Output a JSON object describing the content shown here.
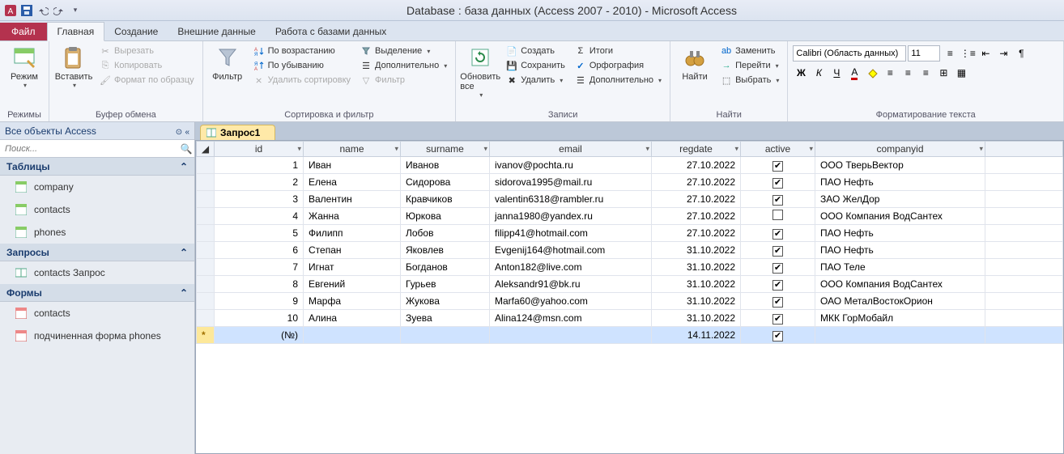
{
  "title": "Database : база данных (Access 2007 - 2010) - Microsoft Access",
  "tabs": {
    "file": "Файл",
    "home": "Главная",
    "create": "Создание",
    "external": "Внешние данные",
    "dbtools": "Работа с базами данных"
  },
  "ribbon": {
    "modes": {
      "view": "Режим",
      "group": "Режимы"
    },
    "clipboard": {
      "paste": "Вставить",
      "cut": "Вырезать",
      "copy": "Копировать",
      "format": "Формат по образцу",
      "group": "Буфер обмена"
    },
    "sortfilter": {
      "filter": "Фильтр",
      "asc": "По возрастанию",
      "desc": "По убыванию",
      "clear": "Удалить сортировку",
      "selection": "Выделение",
      "advanced": "Дополнительно",
      "toggle": "Фильтр",
      "group": "Сортировка и фильтр"
    },
    "records": {
      "refresh": "Обновить все",
      "new": "Создать",
      "save": "Сохранить",
      "delete": "Удалить",
      "totals": "Итоги",
      "spelling": "Орфография",
      "more": "Дополнительно",
      "group": "Записи"
    },
    "find": {
      "find": "Найти",
      "replace": "Заменить",
      "goto": "Перейти",
      "select": "Выбрать",
      "group": "Найти"
    },
    "textfmt": {
      "font": "Calibri (Область данных)",
      "size": "11",
      "group": "Форматирование текста"
    }
  },
  "nav": {
    "header": "Все объекты Access",
    "search_placeholder": "Поиск...",
    "cats": {
      "tables": "Таблицы",
      "queries": "Запросы",
      "forms": "Формы"
    },
    "tables": [
      "company",
      "contacts",
      "phones"
    ],
    "queries": [
      "contacts Запрос"
    ],
    "forms": [
      "contacts",
      "подчиненная форма phones"
    ]
  },
  "doc": {
    "tab": "Запрос1"
  },
  "columns": [
    "id",
    "name",
    "surname",
    "email",
    "regdate",
    "active",
    "companyid"
  ],
  "rows": [
    {
      "id": "1",
      "name": "Иван",
      "surname": "Иванов",
      "email": "ivanov@pochta.ru",
      "regdate": "27.10.2022",
      "active": true,
      "companyid": "ООО ТверьВектор"
    },
    {
      "id": "2",
      "name": "Елена",
      "surname": "Сидорова",
      "email": "sidorova1995@mail.ru",
      "regdate": "27.10.2022",
      "active": true,
      "companyid": "ПАО Нефть"
    },
    {
      "id": "3",
      "name": "Валентин",
      "surname": "Кравчиков",
      "email": "valentin6318@rambler.ru",
      "regdate": "27.10.2022",
      "active": true,
      "companyid": "ЗАО ЖелДор"
    },
    {
      "id": "4",
      "name": "Жанна",
      "surname": "Юркова",
      "email": "janna1980@yandex.ru",
      "regdate": "27.10.2022",
      "active": false,
      "companyid": "ООО Компания ВодСантех"
    },
    {
      "id": "5",
      "name": "Филипп",
      "surname": "Лобов",
      "email": "filipp41@hotmail.com",
      "regdate": "27.10.2022",
      "active": true,
      "companyid": "ПАО Нефть"
    },
    {
      "id": "6",
      "name": "Степан",
      "surname": "Яковлев",
      "email": "Evgenij164@hotmail.com",
      "regdate": "31.10.2022",
      "active": true,
      "companyid": "ПАО Нефть"
    },
    {
      "id": "7",
      "name": "Игнат",
      "surname": "Богданов",
      "email": "Anton182@live.com",
      "regdate": "31.10.2022",
      "active": true,
      "companyid": "ПАО Теле"
    },
    {
      "id": "8",
      "name": "Евгений",
      "surname": "Гурьев",
      "email": "Aleksandr91@bk.ru",
      "regdate": "31.10.2022",
      "active": true,
      "companyid": "ООО Компания ВодСантех"
    },
    {
      "id": "9",
      "name": "Марфа",
      "surname": "Жукова",
      "email": "Marfa60@yahoo.com",
      "regdate": "31.10.2022",
      "active": true,
      "companyid": "ОАО МеталВостокОрион"
    },
    {
      "id": "10",
      "name": "Алина",
      "surname": "Зуева",
      "email": "Alina124@msn.com",
      "regdate": "31.10.2022",
      "active": true,
      "companyid": "МКК ГорМобайл"
    }
  ],
  "newrow": {
    "id_placeholder": "(№)",
    "regdate": "14.11.2022",
    "active": true
  }
}
